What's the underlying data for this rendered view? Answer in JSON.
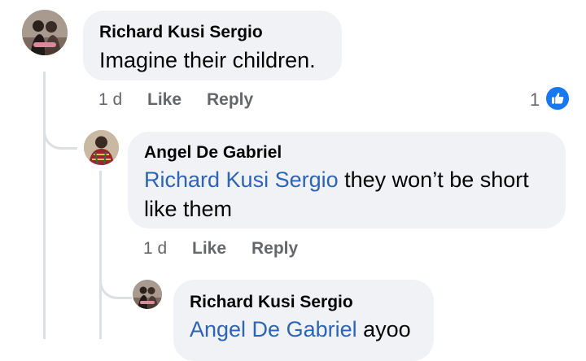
{
  "comments": [
    {
      "author": "Richard Kusi Sergio",
      "text": "Imagine their children.",
      "time": "1 d",
      "like_label": "Like",
      "reply_label": "Reply",
      "reaction_count": "1"
    },
    {
      "author": "Angel De Gabriel",
      "mention": "Richard Kusi Sergio",
      "text_line1": " they won’t be short",
      "text_line2": "like them",
      "time": "1 d",
      "like_label": "Like",
      "reply_label": "Reply"
    },
    {
      "author": "Richard Kusi Sergio",
      "mention": "Angel De Gabriel",
      "text": " ayoo"
    }
  ],
  "colors": {
    "bubble": "#f0f2f5",
    "mention": "#2d64b4",
    "meta": "#65676b",
    "like_reaction": "#1877f2",
    "thread_line": "#dcdfe3"
  },
  "icons": [
    "like-reaction-icon"
  ]
}
